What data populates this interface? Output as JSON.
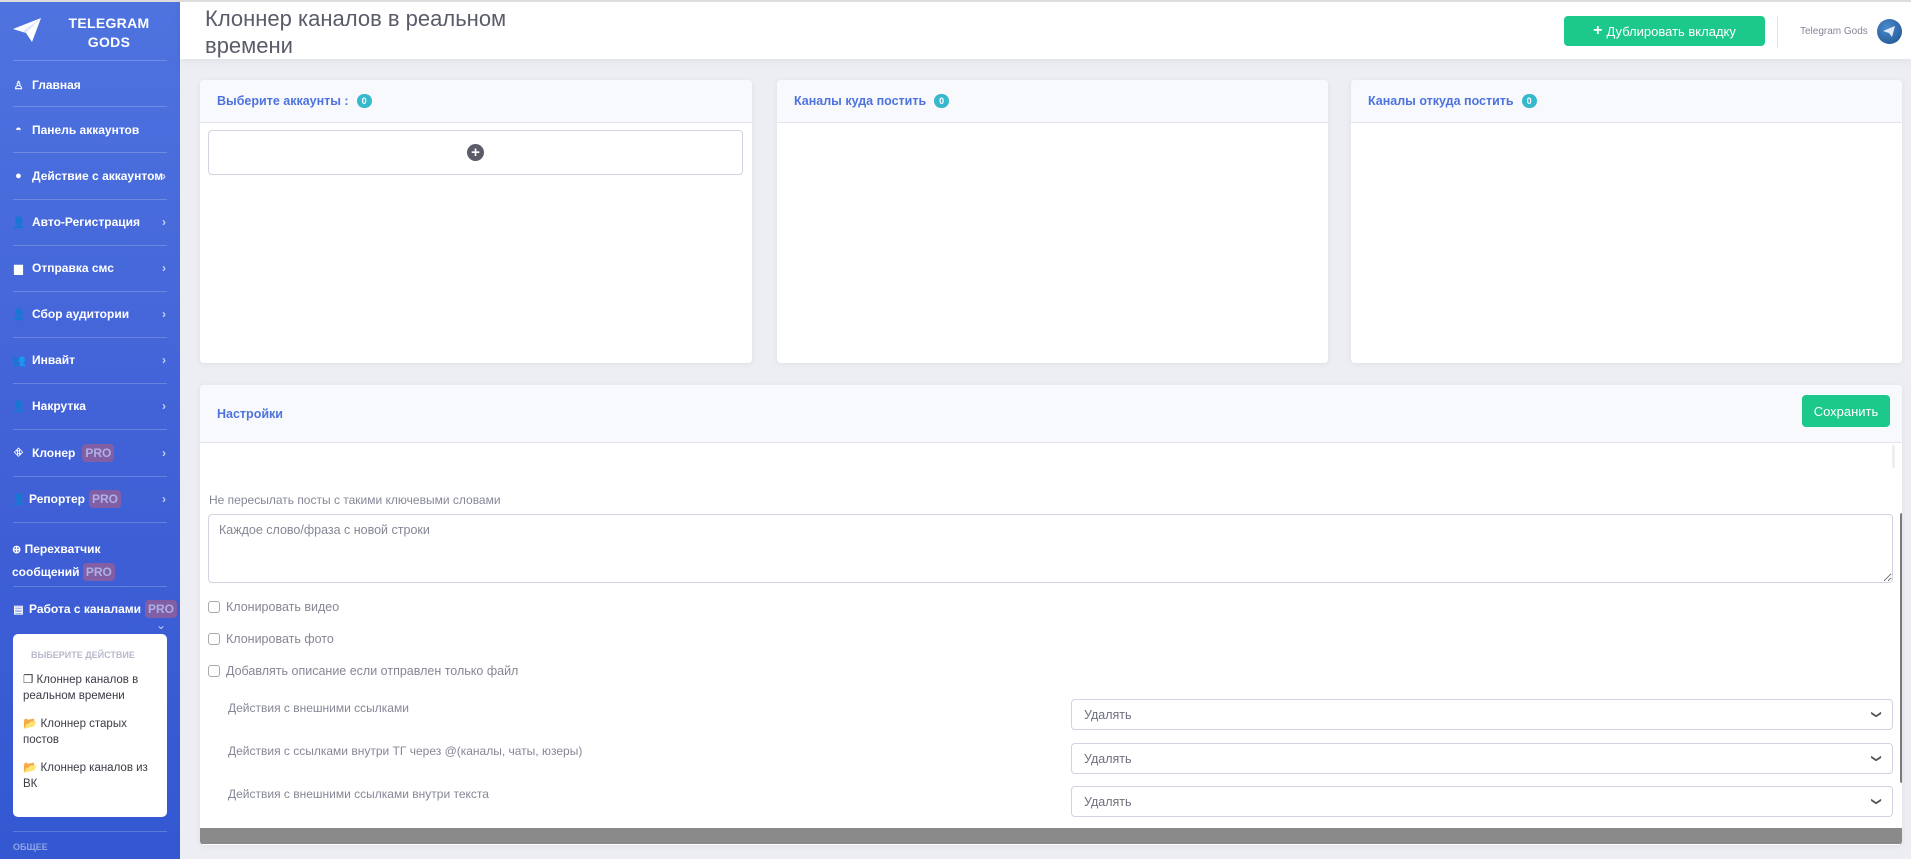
{
  "brand": {
    "name": "TELEGRAM GODS",
    "icon": "paper-plane-icon"
  },
  "sidebar": {
    "items": [
      {
        "label": "Главная",
        "icon": "award-icon",
        "chevron": false
      },
      {
        "label": "Панель аккаунтов",
        "icon": "dashboard-gauge-icon",
        "chevron": false
      },
      {
        "label": "Действие с аккаунтом",
        "icon": "chevron-circle-icon",
        "chevron": true
      },
      {
        "label": "Авто-Регистрация",
        "icon": "user-plus-icon",
        "chevron": true
      },
      {
        "label": "Отправка смс",
        "icon": "comment-icon",
        "chevron": true
      },
      {
        "label": "Сбор аудитории",
        "icon": "user-cog-icon",
        "chevron": true
      },
      {
        "label": "Инвайт",
        "icon": "users-icon",
        "chevron": true
      },
      {
        "label": "Накрутка",
        "icon": "user-cog-icon",
        "chevron": true
      },
      {
        "label": "Клонер",
        "icon": "sitemap-icon",
        "chevron": true,
        "badge": "PRO"
      },
      {
        "label": "Репортер",
        "icon": "user-slash-icon",
        "chevron": true,
        "badge": "PRO"
      },
      {
        "label": "Перехватчик сообщений",
        "icon": "crosshairs-icon",
        "chevron": false,
        "badge": "PRO"
      },
      {
        "label": "Работа с каналами",
        "icon": "list-alt-icon",
        "chevron": true,
        "badge": "PRO"
      }
    ],
    "submenu": {
      "heading": "ВЫБЕРИТЕ ДЕЙСТВИЕ",
      "items": [
        {
          "label": "Клоннер каналов в реальном времени",
          "icon": "copy-icon"
        },
        {
          "label": "Клоннер старых постов",
          "icon": "folder-open-icon"
        },
        {
          "label": "Клоннер каналов из ВК",
          "icon": "folder-open-icon"
        }
      ]
    },
    "section_general": "ОБЩЕЕ"
  },
  "header": {
    "title": "Клоннер каналов в реальном времени",
    "duplicate_button": "Дублировать вкладку",
    "user_name": "Telegram Gods"
  },
  "panels": [
    {
      "title": "Выберите аккаунты :",
      "count": "0"
    },
    {
      "title": "Каналы куда постить",
      "count": "0"
    },
    {
      "title": "Каналы откуда постить",
      "count": "0"
    }
  ],
  "settings": {
    "title": "Настройки",
    "save_button": "Сохранить",
    "keywords_label": "Не пересылать посты с такими ключевыми словами",
    "keywords_placeholder": "Каждое слово/фраза с новой строки",
    "checkboxes": [
      {
        "label": "Клонировать видео",
        "checked": false
      },
      {
        "label": "Клонировать фото",
        "checked": false
      },
      {
        "label": "Добавлять описание если отправлен только файл",
        "checked": false
      }
    ],
    "selects": [
      {
        "label": "Действия с внешними ссылками",
        "value": "Удалять"
      },
      {
        "label": "Действия с ссылками внутри ТГ через @(каналы, чаты, юзеры)",
        "value": "Удалять"
      },
      {
        "label": "Действия с внешними ссылками внутри текста",
        "value": "Удалять"
      }
    ]
  },
  "colors": {
    "primary": "#4e73df",
    "success": "#1cc88a",
    "info": "#36b9cc"
  }
}
